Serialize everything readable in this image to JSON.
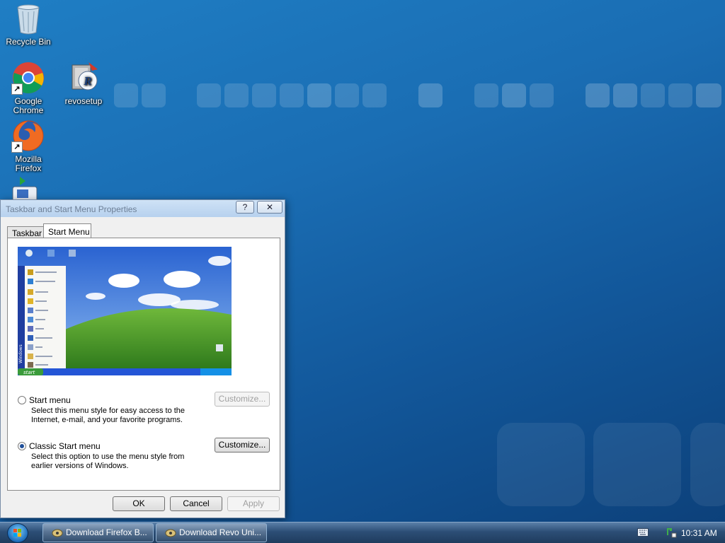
{
  "desktop": {
    "icons": [
      {
        "label": "Recycle Bin",
        "icon": "recycle-bin-icon"
      },
      {
        "label": "Google\nChrome",
        "icon": "chrome-icon"
      },
      {
        "label": "revosetup",
        "icon": "revo-setup-icon"
      },
      {
        "label": "Mozilla\nFirefox",
        "icon": "firefox-icon"
      }
    ]
  },
  "dialog": {
    "title": "Taskbar and Start Menu Properties",
    "help_label": "?",
    "close_label": "✕",
    "tabs": [
      {
        "label": "Taskbar",
        "active": false
      },
      {
        "label": "Start Menu",
        "active": true
      }
    ],
    "preview": {
      "start_label": "start",
      "start_menu_side_label": "Windows"
    },
    "options": [
      {
        "label": "Start menu",
        "description": "Select this menu style for easy access to the Internet, e-mail, and your favorite programs.",
        "selected": false,
        "button": "Customize...",
        "button_enabled": false
      },
      {
        "label": "Classic Start menu",
        "description": "Select this option to use the menu style from earlier versions of Windows.",
        "selected": true,
        "button": "Customize...",
        "button_enabled": true
      }
    ],
    "buttons": {
      "ok": "OK",
      "cancel": "Cancel",
      "apply": "Apply"
    }
  },
  "taskbar": {
    "start_icon": "windows-start-orb-icon",
    "tasks": [
      {
        "label": "Download Firefox B...",
        "icon": "ie-window-icon"
      },
      {
        "label": "Download Revo Uni...",
        "icon": "ie-window-icon"
      }
    ],
    "tray": {
      "time": "10:31 AM",
      "icons": [
        "keyboard-icon",
        "network-icon"
      ]
    }
  },
  "colors": {
    "desktop_blue": "#1a6db3",
    "taskbar": "#2c4e76",
    "dialog_bg": "#f0f0f0"
  }
}
